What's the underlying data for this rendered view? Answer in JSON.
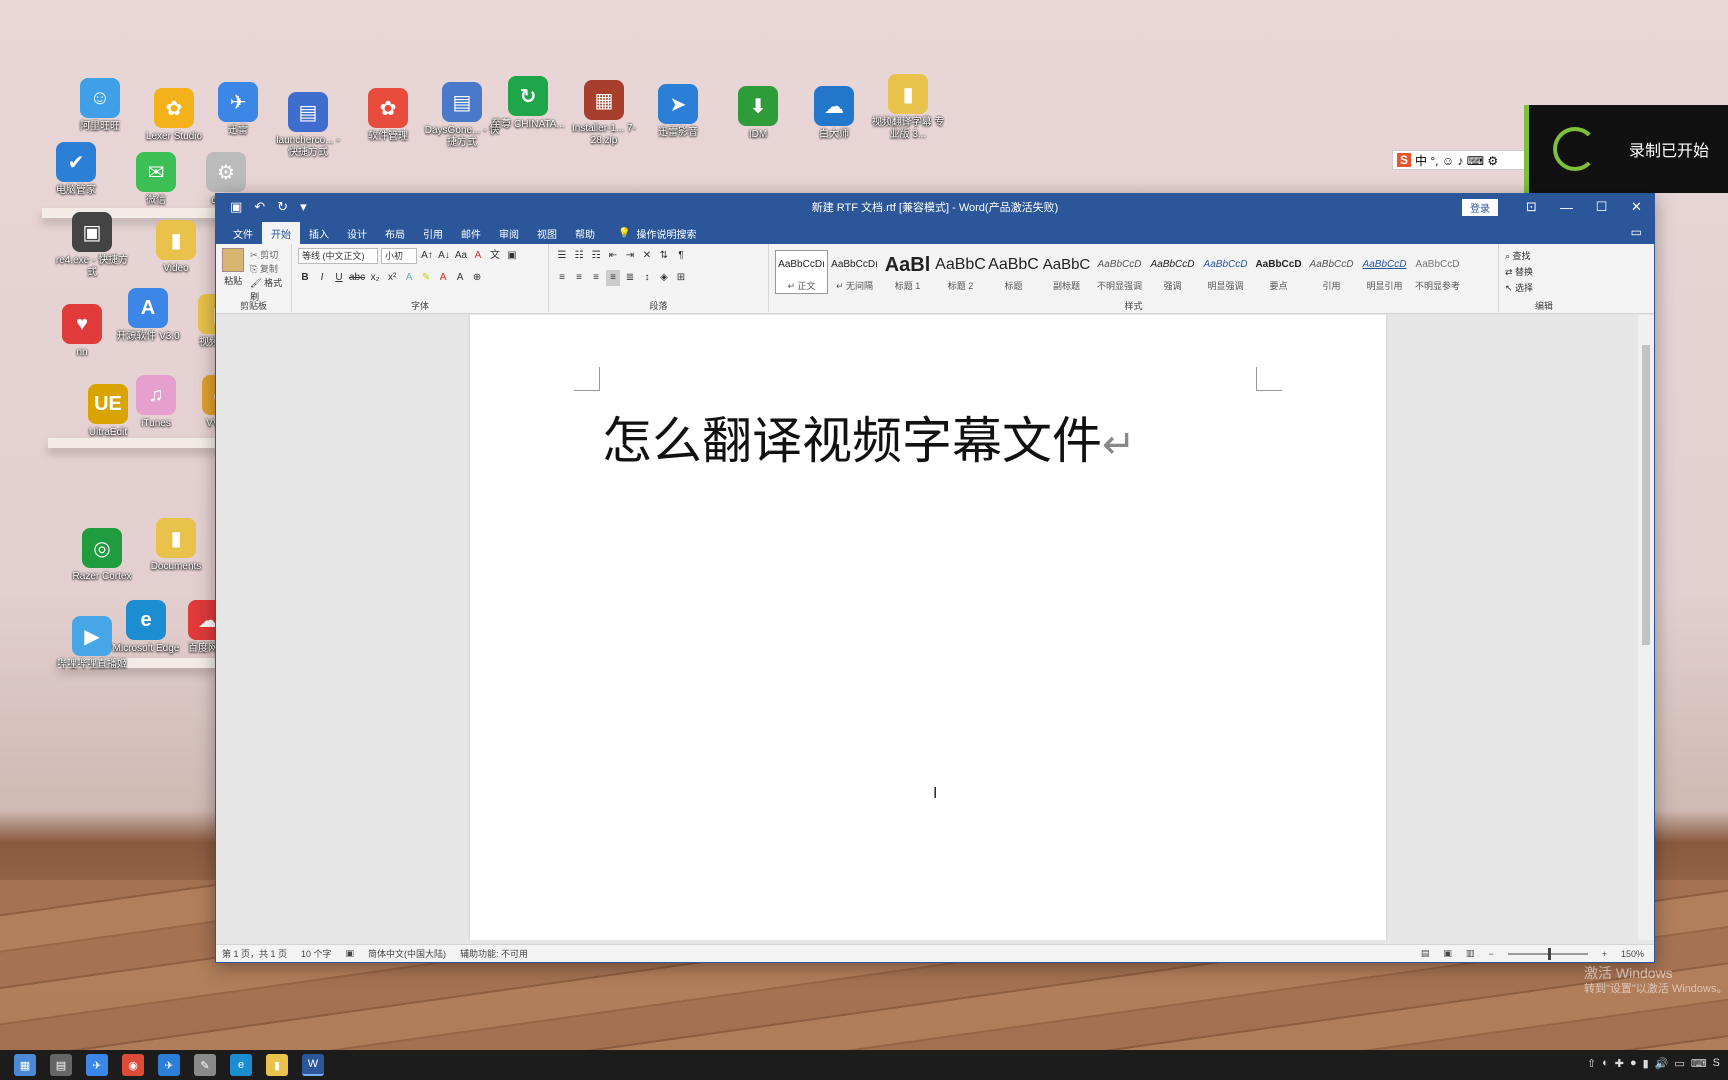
{
  "desktop": {
    "icons": [
      {
        "label": "阿里旺旺",
        "color": "#3fa0e8",
        "glyph": "☺"
      },
      {
        "label": "Lexer Studio",
        "color": "#f3b21a",
        "glyph": "✿"
      },
      {
        "label": "迅雷",
        "color": "#3b86e6",
        "glyph": "✈"
      },
      {
        "label": "launcherco... - 快捷方式",
        "color": "#3f6ccf",
        "glyph": "▤"
      },
      {
        "label": "软件管理",
        "color": "#e84c3d",
        "glyph": "✿"
      },
      {
        "label": "DaysGone... - 快捷方式",
        "color": "#4a79c9",
        "glyph": "▤"
      },
      {
        "label": "至尊 CHINATA...",
        "color": "#1fa64a",
        "glyph": "↻"
      },
      {
        "label": "Installer-1... 7-28.zip",
        "color": "#a83e2c",
        "glyph": "▦"
      },
      {
        "label": "迅雷影音",
        "color": "#2b7fd6",
        "glyph": "➤"
      },
      {
        "label": "IDM",
        "color": "#2f9c3a",
        "glyph": "⬇"
      },
      {
        "label": "白大师",
        "color": "#2277cc",
        "glyph": "☁"
      },
      {
        "label": "视频翻译字幕 专业版 3...",
        "color": "#e8c24a",
        "glyph": "▮"
      },
      {
        "label": "电脑管家",
        "color": "#2b7fd6",
        "glyph": "✔"
      },
      {
        "label": "微信",
        "color": "#3cbf55",
        "glyph": "✉"
      },
      {
        "label": "desk...",
        "color": "#bbbbbb",
        "glyph": "⚙"
      },
      {
        "label": "re4.exe - 快捷方式",
        "color": "#444444",
        "glyph": "▣"
      },
      {
        "label": "Video",
        "color": "#e8c24a",
        "glyph": "▮"
      },
      {
        "label": "开源软件 V3.0",
        "color": "#3b86e6",
        "glyph": "A"
      },
      {
        "label": "视频更...",
        "color": "#e8c24a",
        "glyph": "▮"
      },
      {
        "label": "nn",
        "color": "#e03a3a",
        "glyph": "♥"
      },
      {
        "label": "UltraEdit",
        "color": "#d9a400",
        "glyph": "UE"
      },
      {
        "label": "iTunes",
        "color": "#e6a0d0",
        "glyph": "♫"
      },
      {
        "label": "VV五...",
        "color": "#e0a030",
        "glyph": "◉"
      },
      {
        "label": "Razer Cortex",
        "color": "#1e9c3e",
        "glyph": "◎"
      },
      {
        "label": "Documents",
        "color": "#e8c24a",
        "glyph": "▮"
      },
      {
        "label": "哔哩哔哩直播姬",
        "color": "#47a6e6",
        "glyph": "▶"
      },
      {
        "label": "Microsoft Edge",
        "color": "#1d8dd1",
        "glyph": "e"
      },
      {
        "label": "百度网盘",
        "color": "#e03a3a",
        "glyph": "☁"
      }
    ]
  },
  "recorder": {
    "label": "录制已开始"
  },
  "ime": {
    "sogou": "S",
    "mode": "中 °, ☺ ♪ ⌨ ⚙"
  },
  "word": {
    "title": "新建 RTF 文档.rtf [兼容模式] - Word(产品激活失败)",
    "login": "登录",
    "tabs": [
      "文件",
      "开始",
      "插入",
      "设计",
      "布局",
      "引用",
      "邮件",
      "审阅",
      "视图",
      "帮助"
    ],
    "active_tab": "开始",
    "tell_me": "操作说明搜索",
    "groups": {
      "clipboard": "剪贴板",
      "font": "字体",
      "paragraph": "段落",
      "styles": "样式",
      "editing": "编辑"
    },
    "clipboard": {
      "paste": "粘贴",
      "cut": "剪切",
      "copy": "复制",
      "format_painter": "格式刷"
    },
    "font": {
      "name": "等线 (中文正文)",
      "size": "小初"
    },
    "styles": [
      {
        "preview": "AaBbCcDı",
        "name": "↵ 正文"
      },
      {
        "preview": "AaBbCcDı",
        "name": "↵ 无间隔"
      },
      {
        "preview": "AaBl",
        "name": "标题 1"
      },
      {
        "preview": "AaBbC",
        "name": "标题 2"
      },
      {
        "preview": "AaBbC",
        "name": "标题"
      },
      {
        "preview": "AaBbC",
        "name": "副标题"
      },
      {
        "preview": "AaBbCcD",
        "name": "不明显强调"
      },
      {
        "preview": "AaBbCcD",
        "name": "强调"
      },
      {
        "preview": "AaBbCcD",
        "name": "明显强调"
      },
      {
        "preview": "AaBbCcD",
        "name": "要点"
      },
      {
        "preview": "AaBbCcD",
        "name": "引用"
      },
      {
        "preview": "AaBbCcD",
        "name": "明显引用"
      },
      {
        "preview": "AaBbCcD",
        "name": "不明显参考"
      }
    ],
    "editing": {
      "find": "查找",
      "replace": "替换",
      "select": "选择"
    },
    "document_text": "怎么翻译视频字幕文件",
    "paragraph_mark": "↵",
    "status": {
      "page": "第 1 页，共 1 页",
      "words": "10 个字",
      "language": "简体中文(中国大陆)",
      "accessibility": "辅助功能: 不可用",
      "zoom": "150%"
    }
  },
  "watermark": {
    "line1": "激活 Windows",
    "line2": "转到\"设置\"以激活 Windows。"
  },
  "taskbar": {
    "apps": [
      {
        "name": "calendar-app-icon",
        "color": "#4a8ad6",
        "glyph": "▦"
      },
      {
        "name": "calculator-app-icon",
        "color": "#666666",
        "glyph": "▤"
      },
      {
        "name": "thunder-app-icon",
        "color": "#3b86e6",
        "glyph": "✈"
      },
      {
        "name": "chrome-app-icon",
        "color": "#dd4b39",
        "glyph": "◉"
      },
      {
        "name": "thunder-alt-app-icon",
        "color": "#2b7fd6",
        "glyph": "✈"
      },
      {
        "name": "notes-app-icon",
        "color": "#8a8a8a",
        "glyph": "✎"
      },
      {
        "name": "edge-app-icon",
        "color": "#1d8dd1",
        "glyph": "e"
      },
      {
        "name": "explorer-app-icon",
        "color": "#e8c24a",
        "glyph": "▮"
      },
      {
        "name": "word-app-icon",
        "color": "#2b579a",
        "glyph": "W"
      }
    ],
    "tray": [
      "⇧",
      "◐",
      "✚",
      "●",
      "▮",
      "🔊",
      "▭",
      "⌨",
      "S"
    ]
  }
}
